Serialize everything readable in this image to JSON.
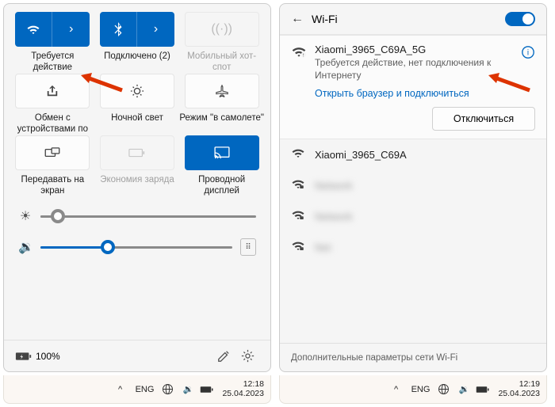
{
  "left": {
    "tiles": {
      "wifi_label": "Требуется действие",
      "bt_label": "Подключено (2)",
      "hotspot_label": "Мобильный хот-спот",
      "share_label": "Обмен с устройствами по",
      "night_label": "Ночной свет",
      "airplane_label": "Режим \"в самолете\"",
      "project_label": "Передавать на экран",
      "battery_saver_label": "Экономия заряда",
      "wired_label": "Проводной дисплей"
    },
    "battery_text": "100%",
    "audio_out_icon": "🔊"
  },
  "right": {
    "title": "Wi-Fi",
    "current": {
      "name": "Xiaomi_3965_C69A_5G",
      "status": "Требуется действие, нет подключения к Интернету",
      "link": "Открыть браузер и подключиться",
      "disconnect": "Отключиться"
    },
    "others": [
      "Xiaomi_3965_C69A",
      "hidden-1",
      "hidden-2",
      "hidden-3"
    ],
    "footer": "Дополнительные параметры сети Wi-Fi"
  },
  "taskbar_left": {
    "lang": "ENG",
    "time": "12:18",
    "date": "25.04.2023"
  },
  "taskbar_right": {
    "lang": "ENG",
    "time": "12:19",
    "date": "25.04.2023"
  }
}
